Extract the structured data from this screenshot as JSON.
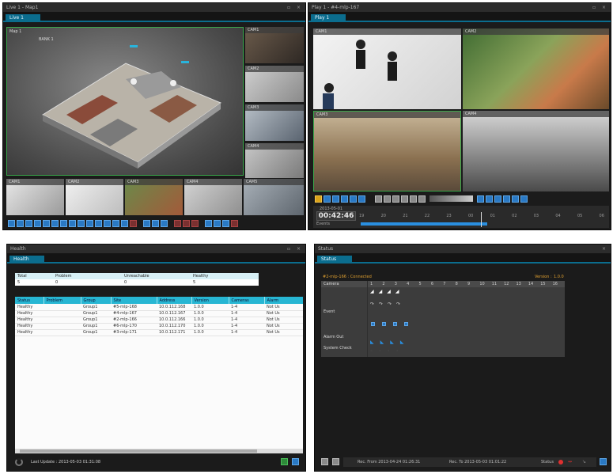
{
  "live": {
    "title": "Live 1 - Map1",
    "tab": "Live 1",
    "map_label": "Map 1",
    "map_bank": "BANK 1",
    "cams": [
      "CAM1",
      "CAM2",
      "CAM3",
      "CAM4",
      "CAM5"
    ],
    "side_cams": [
      "CAM1",
      "CAM2",
      "CAM3",
      "CAM4",
      "CAM5"
    ]
  },
  "play": {
    "title": "Play 1 - #4-mlp-167",
    "tab": "Play 1",
    "cams": [
      "CAM1",
      "CAM2",
      "CAM3",
      "CAM4"
    ],
    "date": "2013-05-01",
    "time": "00:42:46",
    "ruler": [
      "19",
      "20",
      "21",
      "22",
      "23",
      "00",
      "01",
      "02",
      "03",
      "04",
      "05",
      "06"
    ],
    "bottom_label": "Events"
  },
  "health": {
    "title": "Health",
    "tab": "Health",
    "summary_headers": [
      "Total",
      "Problem",
      "Unreachable",
      "Healthy"
    ],
    "summary_values": [
      "5",
      "0",
      "0",
      "5"
    ],
    "columns": [
      "Status",
      "Problem",
      "Group",
      "Site",
      "Address",
      "Version",
      "Cameras",
      "Alarm"
    ],
    "rows": [
      [
        "Healthy",
        "",
        "Group1",
        "#5-mlp-168",
        "10.0.112.168",
        "1.0.0",
        "1-4",
        "Not Us"
      ],
      [
        "Healthy",
        "",
        "Group1",
        "#4-mlp-167",
        "10.0.112.167",
        "1.0.0",
        "1-4",
        "Not Us"
      ],
      [
        "Healthy",
        "",
        "Group1",
        "#2-mlp-166",
        "10.0.112.166",
        "1.0.0",
        "1-4",
        "Not Us"
      ],
      [
        "Healthy",
        "",
        "Group1",
        "#6-mlp-170",
        "10.0.112.170",
        "1.0.0",
        "1-4",
        "Not Us"
      ],
      [
        "Healthy",
        "",
        "Group1",
        "#3-mlp-171",
        "10.0.112.171",
        "1.0.0",
        "1-4",
        "Not Us"
      ]
    ],
    "last_update": "Last Update : 2013-05-03 01:31:08"
  },
  "status": {
    "title": "Status",
    "tab": "Status",
    "site": "#2-mlp-166 : Connected",
    "version_label": "Version :",
    "version": "1.0.0",
    "row_labels": [
      "Camera",
      "Event",
      "Alarm Out",
      "System Check"
    ],
    "col_numbers": [
      "1",
      "2",
      "3",
      "4",
      "5",
      "6",
      "7",
      "8",
      "9",
      "10",
      "11",
      "12",
      "13",
      "14",
      "15",
      "16"
    ],
    "rec_from": "Rec. From 2013-04-24 01:26:31",
    "rec_to": "Rec. To 2013-05-03 01:01:22",
    "status_label": "Status"
  },
  "colors": {
    "accent": "#0b6d8e",
    "table_header": "#27b6d3",
    "green_border": "#3aa84a"
  }
}
